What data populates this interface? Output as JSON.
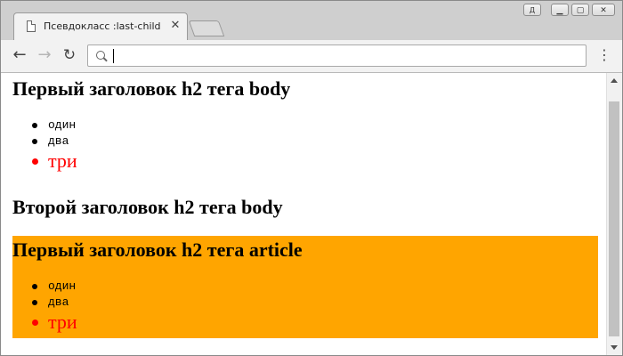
{
  "window": {
    "controls": {
      "user": "Д",
      "minimize": "▁",
      "maximize": "▢",
      "close": "✕"
    }
  },
  "tab": {
    "title": "Псевдокласс :last-child",
    "close": "✕"
  },
  "toolbar": {
    "back": "←",
    "forward": "→",
    "reload": "↻",
    "menu": "⋮",
    "omnibox_value": ""
  },
  "page": {
    "body_heading_1": "Первый заголовок h2 тега body",
    "body_list": [
      "один",
      "два",
      "три"
    ],
    "body_heading_2": "Второй заголовок h2 тега body",
    "article_heading": "Первый заголовок h2 тега article",
    "article_list": [
      "один",
      "два",
      "три"
    ]
  },
  "colors": {
    "article_background": "#ffa500",
    "last_child_text": "#ff0000"
  },
  "icons": {
    "tab": "document-icon",
    "omnibox": "search-icon",
    "menu": "kebab-menu-icon"
  }
}
